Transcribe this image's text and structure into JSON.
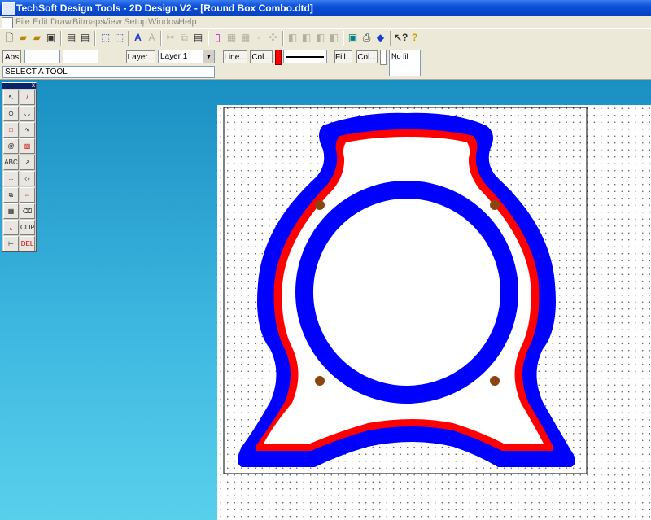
{
  "window": {
    "title": "TechSoft Design Tools - 2D Design V2 - [Round Box Combo.dtd]"
  },
  "menu": [
    "File",
    "Edit",
    "Draw",
    "Bitmaps",
    "View",
    "Setup",
    "Window",
    "Help"
  ],
  "toolbar": {
    "icons": [
      "new-icon",
      "open-icon",
      "open-folder-icon",
      "save-icon",
      "print-setup-icon",
      "print-icon",
      "zoom-icon",
      "zoom-fit-icon",
      "text-size-up-icon",
      "text-size-down-icon",
      "cut-icon",
      "copy-icon",
      "paste-icon",
      "select-frame-icon",
      "grid-icon",
      "snap-icon",
      "rotate-icon",
      "mirror-icon",
      "layer-1-icon",
      "layer-2-icon",
      "layer-3-icon",
      "layer-4-icon",
      "screen-icon",
      "printer-icon",
      "3d-view-icon",
      "help-pointer-icon",
      "help-icon"
    ]
  },
  "props": {
    "abs": "Abs",
    "coord_x": "",
    "coord_y": "",
    "layer_btn": "Layer...",
    "layer_value": "Layer 1",
    "line_btn": "Line...",
    "line_col_btn": "Col...",
    "line_color": "#ff0000",
    "fill_btn": "Fill...",
    "fill_col_btn": "Col...",
    "fill_value": "No fill",
    "status": "SELECT A TOOL"
  },
  "palette": {
    "tools": [
      {
        "name": "select-arrow-tool",
        "glyph": "↖"
      },
      {
        "name": "line-tool",
        "glyph": "/"
      },
      {
        "name": "circle-tool",
        "glyph": "⊙"
      },
      {
        "name": "arc-tool",
        "glyph": "◡"
      },
      {
        "name": "rectangle-tool",
        "glyph": "□"
      },
      {
        "name": "curve-tool",
        "glyph": "∿"
      },
      {
        "name": "offset-tool",
        "glyph": "@"
      },
      {
        "name": "hatch-tool",
        "glyph": "▨"
      },
      {
        "name": "text-tool",
        "glyph": "ABC"
      },
      {
        "name": "dimension-tool",
        "glyph": "↗"
      },
      {
        "name": "points-tool",
        "glyph": "∴"
      },
      {
        "name": "trim-tool",
        "glyph": "◇"
      },
      {
        "name": "copy-tool",
        "glyph": "⧉"
      },
      {
        "name": "align-tool",
        "glyph": "⇔"
      },
      {
        "name": "pattern-tool",
        "glyph": "▦"
      },
      {
        "name": "eraser-tool",
        "glyph": "⌫"
      },
      {
        "name": "fillet-tool",
        "glyph": "⌞"
      },
      {
        "name": "clip-tool",
        "glyph": "CLIP"
      },
      {
        "name": "measure-tool",
        "glyph": "⊢"
      },
      {
        "name": "delete-any-tool",
        "glyph": "DEL ANY"
      }
    ]
  },
  "drawing": {
    "outer_color": "#0000ff",
    "inner_color": "#ff0000",
    "ring_color": "#0000ff",
    "hole_color": "#8b4513"
  }
}
